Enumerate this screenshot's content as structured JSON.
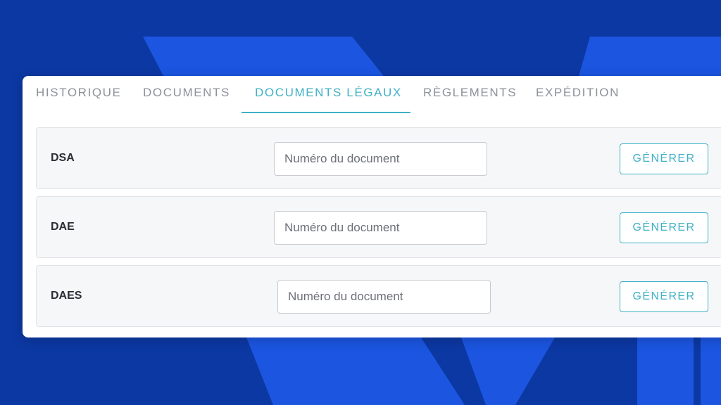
{
  "colors": {
    "background": "#0c38a3",
    "accent_shape": "#1b55e0",
    "active_tab": "#3fb0c6",
    "inactive_tab": "#8d9198"
  },
  "tabs": [
    {
      "label": "HISTORIQUE",
      "active": false
    },
    {
      "label": "DOCUMENTS",
      "active": false
    },
    {
      "label": "DOCUMENTS LÉGAUX",
      "active": true
    },
    {
      "label": "RÈGLEMENTS",
      "active": false
    },
    {
      "label": "EXPÉDITION",
      "active": false
    }
  ],
  "rows": [
    {
      "label": "DSA",
      "input_placeholder": "Numéro du document",
      "input_value": "",
      "button_label": "GÉNÉRER"
    },
    {
      "label": "DAE",
      "input_placeholder": "Numéro du document",
      "input_value": "",
      "button_label": "GÉNÉRER"
    },
    {
      "label": "DAES",
      "input_placeholder": "Numéro du document",
      "input_value": "",
      "button_label": "GÉNÉRER"
    }
  ]
}
